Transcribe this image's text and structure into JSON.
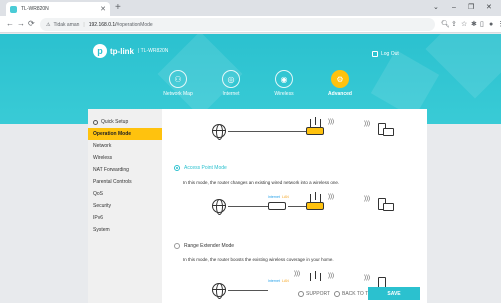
{
  "browser": {
    "tab_title": "TL-WR820N",
    "new_tab": "+",
    "security_label": "Tidak aman",
    "url": "192.168.0.1/",
    "url_hash": "#operationMode"
  },
  "header": {
    "brand": "tp-link",
    "model": "TL-WR820N",
    "logout": "Log Out",
    "nav": [
      {
        "label": "Network Map"
      },
      {
        "label": "Internet"
      },
      {
        "label": "Wireless"
      },
      {
        "label": "Advanced"
      }
    ]
  },
  "sidebar": {
    "items": [
      {
        "label": "Quick Setup"
      },
      {
        "label": "Operation Mode"
      },
      {
        "label": "Network"
      },
      {
        "label": "Wireless"
      },
      {
        "label": "NAT Forwarding"
      },
      {
        "label": "Parental Controls"
      },
      {
        "label": "QoS"
      },
      {
        "label": "Security"
      },
      {
        "label": "IPv6"
      },
      {
        "label": "System"
      }
    ]
  },
  "modes": {
    "access_point": {
      "title": "Access Point Mode",
      "desc": "In this mode, the router changes an existing wired network into a wireless one.",
      "selected": true
    },
    "range_extender": {
      "title": "Range Extender Mode",
      "desc": "In this mode, the router boosts the existing wireless coverage in your home.",
      "selected": false
    },
    "diagram_labels": {
      "internet": "Internet",
      "lan": "LAN"
    }
  },
  "footer": {
    "support": "SUPPORT",
    "back_to_top": "BACK TO TOP",
    "save": "SAVE"
  },
  "colors": {
    "accent": "#2bc1cf",
    "highlight": "#ffc20e"
  }
}
